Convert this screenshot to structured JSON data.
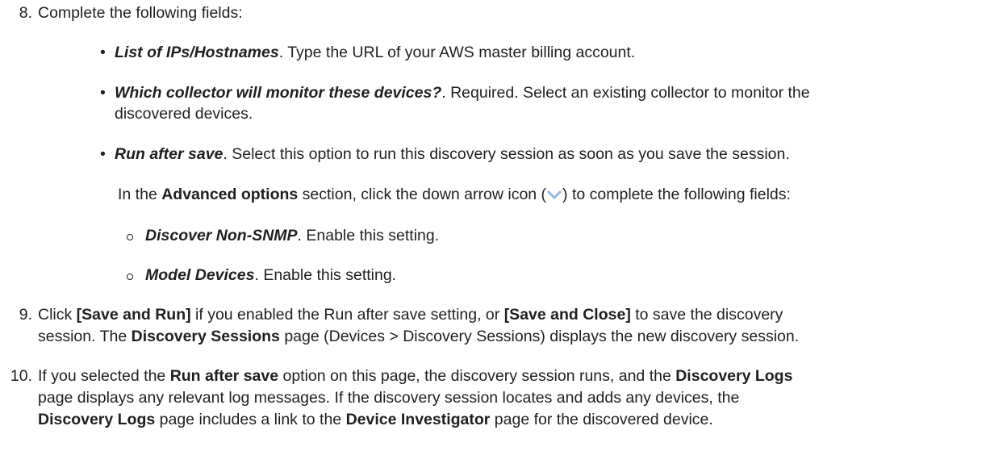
{
  "steps": {
    "s8": {
      "number": "8.",
      "text": "Complete the following fields:",
      "bullets": [
        {
          "term": "List of IPs/Hostnames",
          "rest": ". Type the URL of your AWS master billing account."
        },
        {
          "term": "Which collector will monitor these devices?",
          "rest": ". Required. Select an existing collector to monitor the",
          "rest2": "discovered devices."
        },
        {
          "term": "Run after save",
          "rest": ". Select this option to run this discovery session as soon as you save the session."
        }
      ],
      "advanced_note": {
        "pre": "In the ",
        "bold": "Advanced options",
        "mid": " section, click the down arrow icon (",
        "post": ") to complete the following fields:"
      },
      "subbullets": [
        {
          "term": "Discover Non-SNMP",
          "rest": ". Enable this setting."
        },
        {
          "term": "Model Devices",
          "rest": ". Enable this setting."
        }
      ]
    },
    "s9": {
      "number": "9.",
      "line1_pre": "Click ",
      "line1_b1": "[Save and Run]",
      "line1_mid": " if you enabled the Run after save setting, or ",
      "line1_b2": "[Save and Close]",
      "line1_post": " to save the discovery",
      "line2_pre": "session. The ",
      "line2_b": "Discovery Sessions",
      "line2_post": " page (Devices > Discovery Sessions) displays the new discovery session."
    },
    "s10": {
      "number": "10.",
      "l1_pre": "If you selected the ",
      "l1_b1": "Run after save",
      "l1_mid": " option on this page, the discovery session runs, and the ",
      "l1_b2": "Discovery Logs",
      "l2_pre": "page displays any relevant log messages. If the discovery session locates and adds any devices, the",
      "l3_b1": "Discovery Logs",
      "l3_mid": " page includes a link to the ",
      "l3_b2": "Device Investigator",
      "l3_post": " page for the discovered device."
    }
  },
  "icons": {
    "down_arrow": "chevron-down-icon",
    "down_arrow_color": "#8fb8e8"
  }
}
